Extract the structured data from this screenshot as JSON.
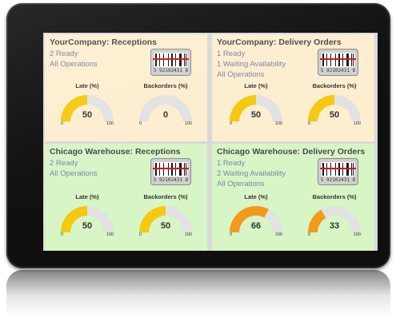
{
  "colors": {
    "yellow_card": "#fdeed0",
    "green_card": "#d8f5c6",
    "gauge_yellow": "#f6c80e",
    "gauge_orange": "#f29a1a",
    "gauge_track": "#e2e2e2",
    "link_text": "#7a86a8"
  },
  "icon_barcode": "barcode-scanner-icon",
  "cards": [
    {
      "title": "YourCompany: Receptions",
      "lines": [
        "2 Ready",
        "All Operations"
      ],
      "barcode_number": "5 92102431 8",
      "gauges": [
        {
          "label": "Late (%)",
          "value": "50",
          "fraction": 0.5,
          "min": "0",
          "max": "100",
          "color": "yellow"
        },
        {
          "label": "Backorders (%)",
          "value": "0",
          "fraction": 0,
          "min": "0",
          "max": "100",
          "color": "yellow"
        }
      ]
    },
    {
      "title": "YourCompany: Delivery Orders",
      "lines": [
        "1 Ready",
        "1 Waiting Availability",
        "All Operations"
      ],
      "barcode_number": "5 92102431 8",
      "gauges": [
        {
          "label": "Late (%)",
          "value": "50",
          "fraction": 0.5,
          "min": "0",
          "max": "100",
          "color": "yellow"
        },
        {
          "label": "Backorders (%)",
          "value": "50",
          "fraction": 0.5,
          "min": "0",
          "max": "100",
          "color": "yellow"
        }
      ]
    },
    {
      "title": "Chicago Warehouse: Receptions",
      "lines": [
        "2 Ready",
        "All Operations"
      ],
      "barcode_number": "5 92102431 8",
      "gauges": [
        {
          "label": "Late (%)",
          "value": "50",
          "fraction": 0.5,
          "min": "0",
          "max": "100",
          "color": "yellow"
        },
        {
          "label": "Backorders (%)",
          "value": "50",
          "fraction": 0.5,
          "min": "0",
          "max": "100",
          "color": "yellow"
        }
      ]
    },
    {
      "title": "Chicago Warehouse: Delivery Orders",
      "lines": [
        "1 Ready",
        "2 Waiting Availability",
        "All Operations"
      ],
      "barcode_number": "5 92102431 8",
      "gauges": [
        {
          "label": "Late (%)",
          "value": "66",
          "fraction": 0.66,
          "min": "0",
          "max": "100",
          "color": "orange"
        },
        {
          "label": "Backorders (%)",
          "value": "33",
          "fraction": 0.33,
          "min": "0",
          "max": "100",
          "color": "orange"
        }
      ]
    }
  ]
}
